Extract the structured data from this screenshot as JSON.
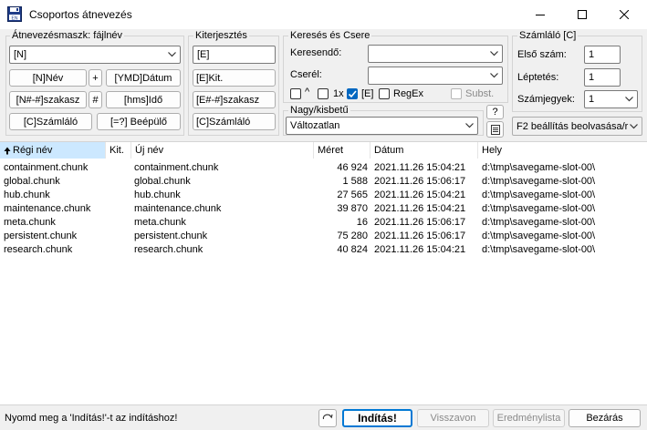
{
  "window": {
    "title": "Csoportos átnevezés",
    "app_icon": "floppy-disk-icon"
  },
  "mask_group": {
    "title": "Átnevezésmaszk: fájlnév",
    "value": "[N]",
    "buttons": {
      "name": "[N]Név",
      "plus": "+",
      "ymd_date": "[YMD]Dátum",
      "name_range": "[N#-#]szakasz",
      "hash": "#",
      "hms_time": "[hms]Idő",
      "counter": "[C]Számláló",
      "plugin": "[=?] Beépülő"
    }
  },
  "ext_group": {
    "title": "Kiterjesztés",
    "value": "[E]",
    "buttons": {
      "ext": "[E]Kit.",
      "ext_range": "[E#-#]szakasz",
      "counter": "[C]Számláló"
    }
  },
  "search_group": {
    "title": "Keresés és Csere",
    "search_label": "Keresendő:",
    "search_value": "",
    "replace_label": "Cserél:",
    "replace_value": "",
    "options": {
      "caret": "^",
      "once": "1x",
      "ext": "[E]",
      "regex": "RegEx",
      "subst": "Subst."
    }
  },
  "case_group": {
    "title": "Nagy/kisbetű",
    "value": "Változatlan",
    "help": "?"
  },
  "counter_group": {
    "title": "Számláló [C]",
    "first_label": "Első szám:",
    "first_value": "1",
    "step_label": "Léptetés:",
    "step_value": "1",
    "digits_label": "Számjegyek:",
    "digits_value": "1",
    "f2_value": "F2 beállítás beolvasása/r"
  },
  "table": {
    "columns": [
      "Régi név",
      "Kit.",
      "Új név",
      "Méret",
      "Dátum",
      "Hely"
    ],
    "rows": [
      {
        "old": "containment.chunk",
        "ext": "",
        "new": "containment.chunk",
        "size": "46 924",
        "date": "2021.11.26 15:04:21",
        "path": "d:\\tmp\\savegame-slot-00\\"
      },
      {
        "old": "global.chunk",
        "ext": "",
        "new": "global.chunk",
        "size": "1 588",
        "date": "2021.11.26 15:06:17",
        "path": "d:\\tmp\\savegame-slot-00\\"
      },
      {
        "old": "hub.chunk",
        "ext": "",
        "new": "hub.chunk",
        "size": "27 565",
        "date": "2021.11.26 15:04:21",
        "path": "d:\\tmp\\savegame-slot-00\\"
      },
      {
        "old": "maintenance.chunk",
        "ext": "",
        "new": "maintenance.chunk",
        "size": "39 870",
        "date": "2021.11.26 15:04:21",
        "path": "d:\\tmp\\savegame-slot-00\\"
      },
      {
        "old": "meta.chunk",
        "ext": "",
        "new": "meta.chunk",
        "size": "16",
        "date": "2021.11.26 15:06:17",
        "path": "d:\\tmp\\savegame-slot-00\\"
      },
      {
        "old": "persistent.chunk",
        "ext": "",
        "new": "persistent.chunk",
        "size": "75 280",
        "date": "2021.11.26 15:06:17",
        "path": "d:\\tmp\\savegame-slot-00\\"
      },
      {
        "old": "research.chunk",
        "ext": "",
        "new": "research.chunk",
        "size": "40 824",
        "date": "2021.11.26 15:04:21",
        "path": "d:\\tmp\\savegame-slot-00\\"
      }
    ]
  },
  "status": {
    "message": "Nyomd meg a 'Indítás!'-t az indításhoz!",
    "start": "Indítás!",
    "undo": "Visszavon",
    "results": "Eredménylista",
    "close": "Bezárás"
  },
  "colors": {
    "accent": "#0067c0",
    "sorted_header": "#cce8ff",
    "default_button_border": "#0078d4"
  }
}
